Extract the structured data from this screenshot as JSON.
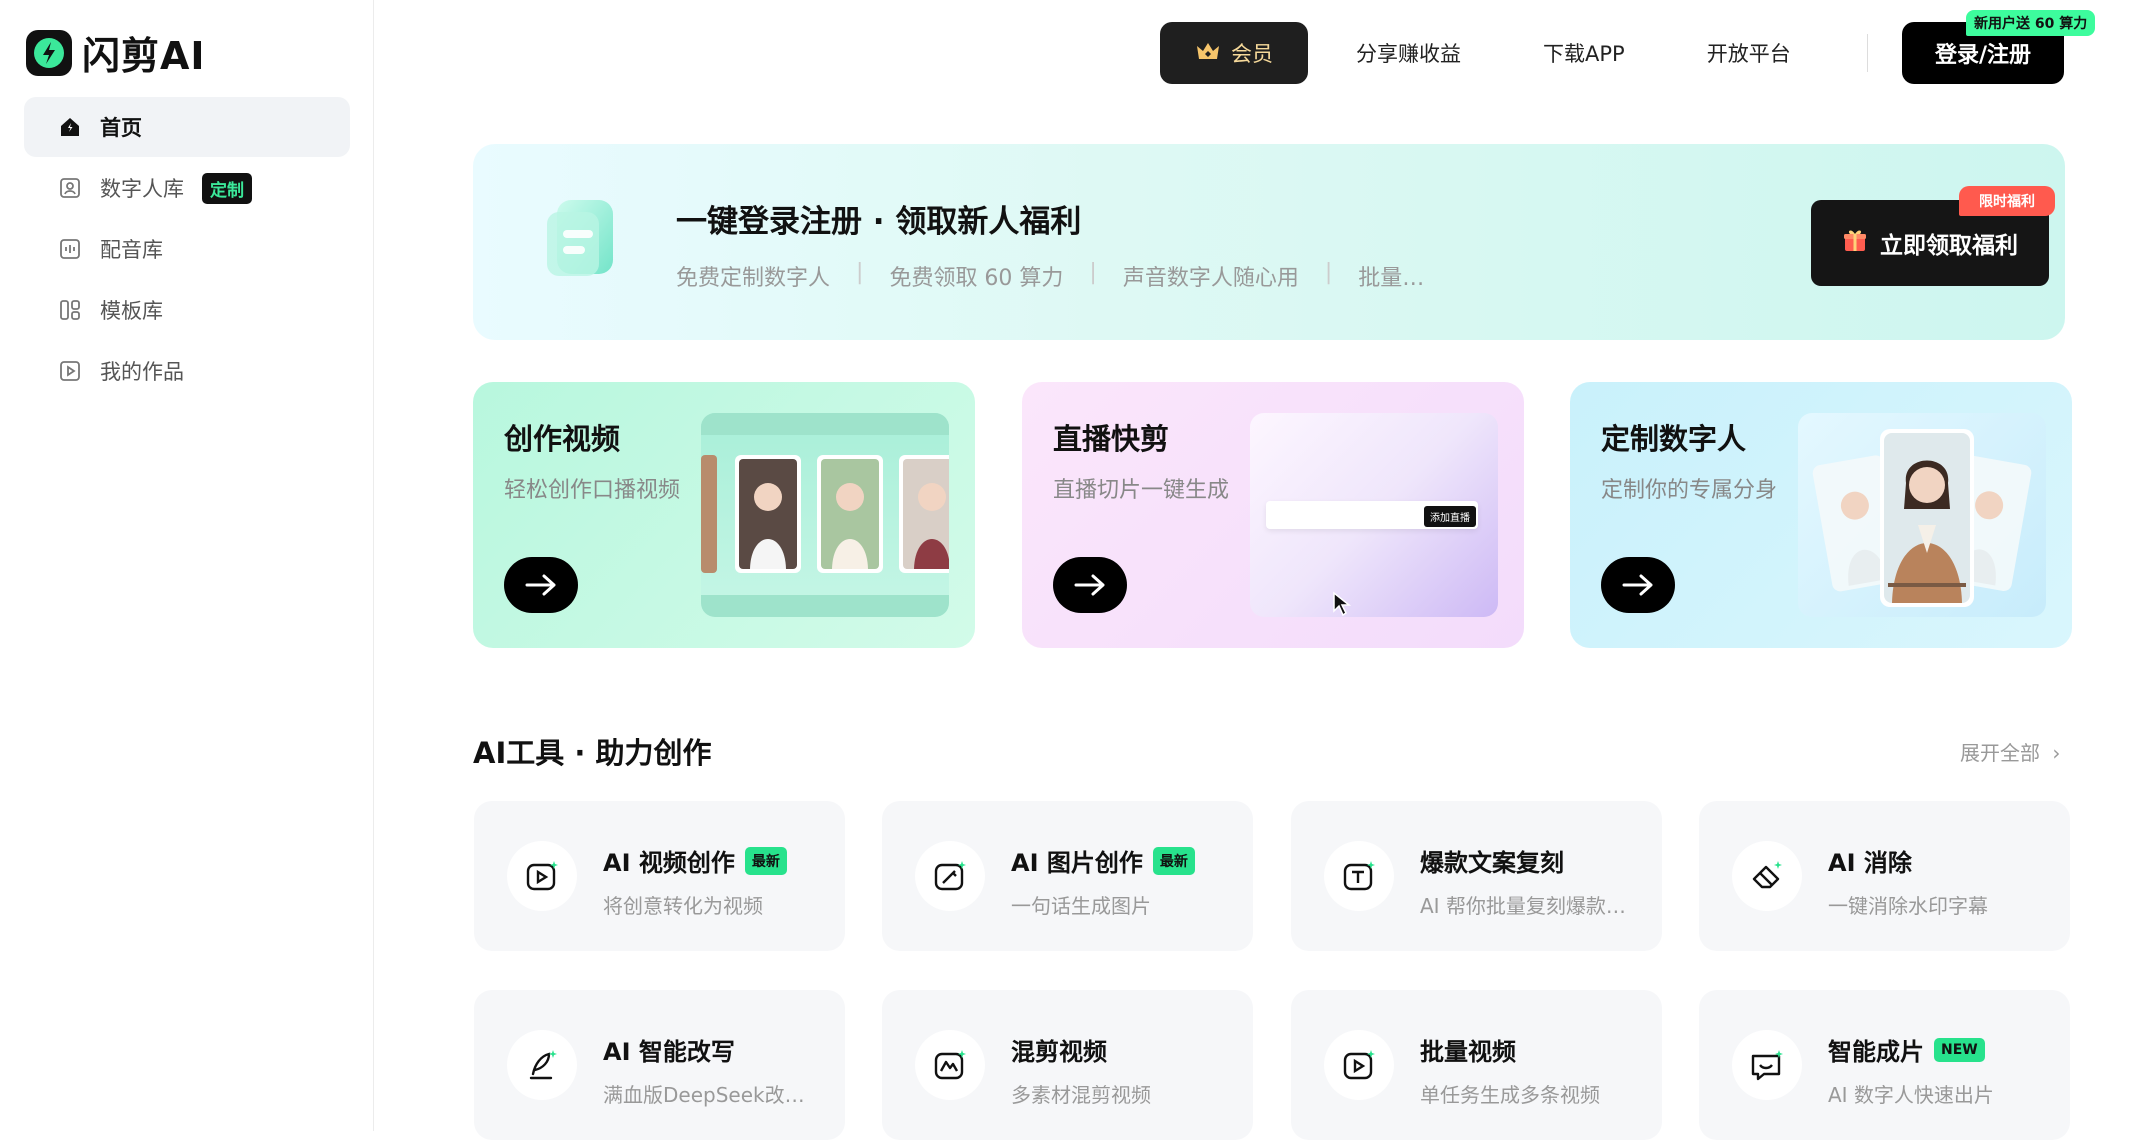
{
  "app": {
    "brand": "闪剪AI",
    "accent": "#3be89a"
  },
  "sidebar": {
    "items": [
      {
        "label": "首页",
        "icon": "home-icon"
      },
      {
        "label": "数字人库",
        "icon": "avatar-library-icon",
        "badge": "定制"
      },
      {
        "label": "配音库",
        "icon": "audio-library-icon"
      },
      {
        "label": "模板库",
        "icon": "template-icon"
      },
      {
        "label": "我的作品",
        "icon": "my-works-icon"
      }
    ]
  },
  "header": {
    "vip": "会员",
    "links": [
      "分享赚收益",
      "下载APP",
      "开放平台"
    ],
    "login": "登录/注册",
    "login_tip": "新用户送 60 算力"
  },
  "banner": {
    "title": "一键登录注册 · 领取新人福利",
    "subs": [
      "免费定制数字人",
      "免费领取 60 算力",
      "声音数字人随心用",
      "批量…"
    ],
    "button": "立即领取福利",
    "tag": "限时福利"
  },
  "cards": [
    {
      "title": "创作视频",
      "sub": "轻松创作口播视频"
    },
    {
      "title": "直播快剪",
      "sub": "直播切片一键生成",
      "inner_label": "添加直播"
    },
    {
      "title": "定制数字人",
      "sub": "定制你的专属分身"
    }
  ],
  "tools_section": {
    "title": "AI工具 · 助力创作",
    "expand": "展开全部"
  },
  "tools": [
    {
      "name": "AI 视频创作",
      "desc": "将创意转化为视频",
      "tag": "最新",
      "icon": "ai-video-icon"
    },
    {
      "name": "AI 图片创作",
      "desc": "一句话生成图片",
      "tag": "最新",
      "icon": "ai-image-icon"
    },
    {
      "name": "爆款文案复刻",
      "desc": "AI 帮你批量复刻爆款…",
      "tag": "",
      "icon": "copywriting-icon"
    },
    {
      "name": "AI 消除",
      "desc": "一键消除水印字幕",
      "tag": "",
      "icon": "eraser-icon"
    },
    {
      "name": "AI 智能改写",
      "desc": "满血版DeepSeek改…",
      "tag": "",
      "icon": "rewrite-icon"
    },
    {
      "name": "混剪视频",
      "desc": "多素材混剪视频",
      "tag": "",
      "icon": "mix-video-icon"
    },
    {
      "name": "批量视频",
      "desc": "单任务生成多条视频",
      "tag": "",
      "icon": "batch-video-icon"
    },
    {
      "name": "智能成片",
      "desc": "AI 数字人快速出片",
      "tag": "NEW",
      "icon": "smart-film-icon"
    }
  ]
}
